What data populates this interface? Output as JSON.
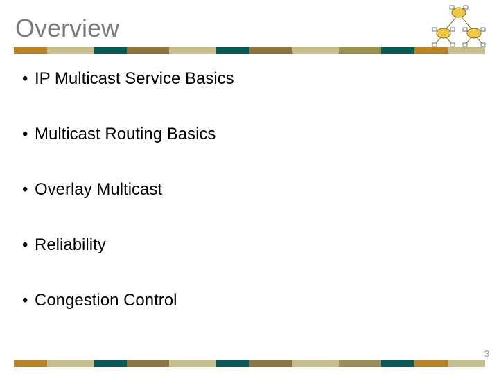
{
  "title": "Overview",
  "bullets": [
    "IP Multicast Service Basics",
    "Multicast Routing Basics",
    "Overlay Multicast",
    "Reliability",
    "Congestion Control"
  ],
  "page_number": "3",
  "theme": {
    "title_color": "#7a7a7a",
    "bar_colors": [
      "#b5842a",
      "#c6be8e",
      "#0b5a57",
      "#8c7443",
      "#c6be8e",
      "#0b5a57",
      "#8c7443",
      "#c6be8e",
      "#9a8d56",
      "#0b5a57",
      "#b5842a",
      "#c6be8e"
    ]
  }
}
